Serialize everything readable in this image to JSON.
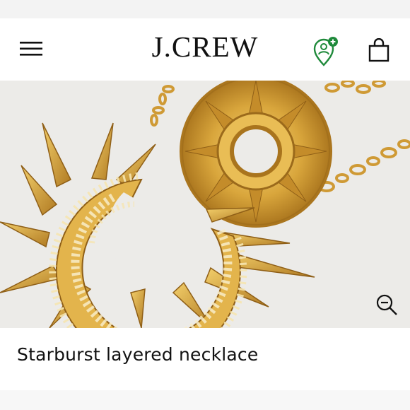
{
  "header": {
    "logo_text": "J.CREW",
    "menu_icon": "hamburger-menu-icon",
    "store_icon": "store-locator-icon",
    "bag_icon": "shopping-bag-icon"
  },
  "product": {
    "title": "Starburst layered necklace",
    "zoom_icon": "zoom-out-icon"
  },
  "colors": {
    "accent_green": "#1f8a3b",
    "gold": "#d8a53a",
    "hero_background": "#ecebe8"
  }
}
